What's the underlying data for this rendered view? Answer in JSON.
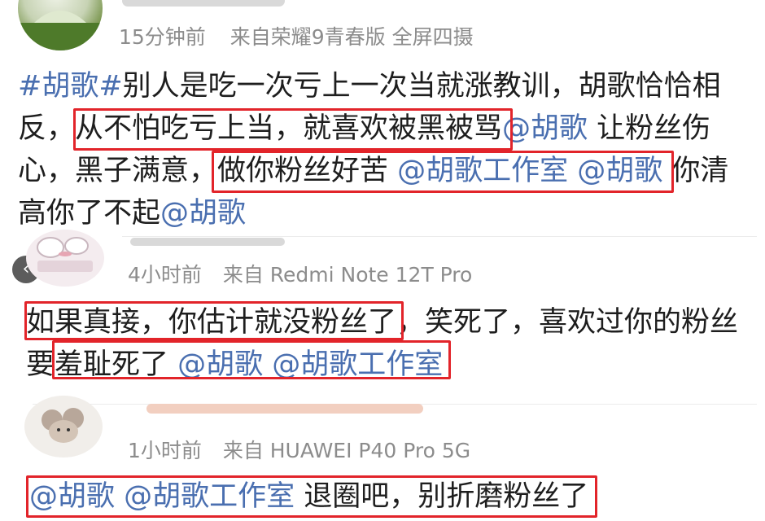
{
  "posts": [
    {
      "time": "15分钟前",
      "source": "来自荣耀9青春版 全屏四摄",
      "lines": [
        [
          {
            "t": "#胡歌#",
            "link": true
          },
          {
            "t": "别人是吃一次亏上一次当就涨教训，胡歌恰恰相",
            "link": false
          }
        ],
        [
          {
            "t": "反，",
            "link": false
          },
          {
            "t": "从不怕吃亏上当，就喜欢被黑被骂",
            "link": false
          },
          {
            "t": "@胡歌",
            "link": true
          },
          {
            "t": " 让粉丝伤",
            "link": false
          }
        ],
        [
          {
            "t": "心，黑子满意，",
            "link": false
          },
          {
            "t": "做你粉丝好苦 ",
            "link": false
          },
          {
            "t": "@胡歌工作室 @胡歌",
            "link": true
          },
          {
            "t": " 你清",
            "link": false
          }
        ],
        [
          {
            "t": "高你了不起",
            "link": false
          },
          {
            "t": "@胡歌",
            "link": true
          }
        ]
      ]
    },
    {
      "time": "4小时前",
      "source": "来自 Redmi Note 12T Pro",
      "lines": [
        [
          {
            "t": "如果真接，你估计就没粉丝了",
            "link": false
          },
          {
            "t": "，笑死了，喜欢过你的粉丝",
            "link": false
          }
        ],
        [
          {
            "t": "要",
            "link": false
          },
          {
            "t": "羞耻死了 ",
            "link": false
          },
          {
            "t": "@胡歌 @胡歌工作室",
            "link": true
          }
        ]
      ]
    },
    {
      "time": "1小时前",
      "source": "来自 HUAWEI P40 Pro 5G",
      "lines": [
        [
          {
            "t": "@胡歌 @胡歌工作室",
            "link": true
          },
          {
            "t": " 退圈吧，别折磨粉丝了",
            "link": false
          }
        ]
      ]
    }
  ],
  "back_icon": "chevron-left-icon",
  "colors": {
    "highlight": "#e2242a",
    "link": "#4a6fb0",
    "meta": "#8c8c8c"
  }
}
